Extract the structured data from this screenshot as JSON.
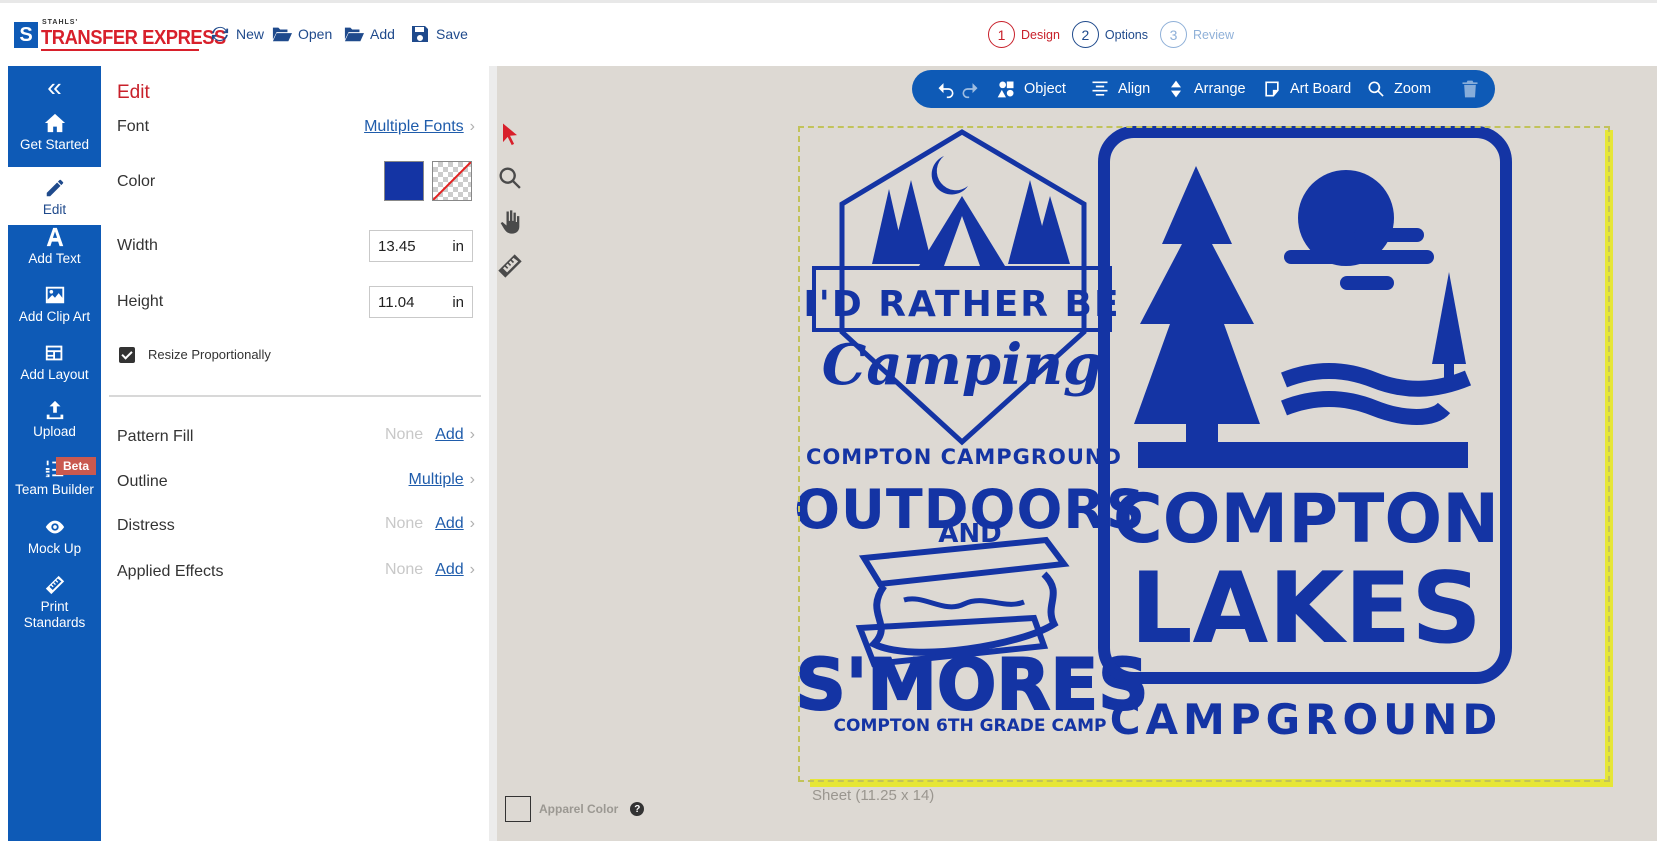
{
  "brand": {
    "small": "STAHLS'",
    "name": "TRANSFER EXPRESS",
    "mark": "S"
  },
  "file_menu": {
    "new": "New",
    "open": "Open",
    "add": "Add",
    "save": "Save"
  },
  "steps": [
    {
      "num": "1",
      "label": "Design"
    },
    {
      "num": "2",
      "label": "Options"
    },
    {
      "num": "3",
      "label": "Review"
    }
  ],
  "nav": {
    "collapse": "«",
    "items": [
      {
        "label": "Get Started"
      },
      {
        "label": "Edit"
      },
      {
        "label": "Add Text"
      },
      {
        "label": "Add Clip Art"
      },
      {
        "label": "Add Layout"
      },
      {
        "label": "Upload"
      },
      {
        "label": "Team Builder",
        "badge": "Beta"
      },
      {
        "label": "Mock Up"
      },
      {
        "label": "Print Standards"
      }
    ]
  },
  "edit_panel": {
    "title": "Edit",
    "font": {
      "label": "Font",
      "value": "Multiple Fonts"
    },
    "color": {
      "label": "Color",
      "swatch": "#1434a4"
    },
    "width": {
      "label": "Width",
      "value": "13.45",
      "unit": "in"
    },
    "height": {
      "label": "Height",
      "value": "11.04",
      "unit": "in"
    },
    "resize": {
      "label": "Resize Proportionally",
      "checked": true
    },
    "pattern_fill": {
      "label": "Pattern Fill",
      "state": "None",
      "action": "Add"
    },
    "outline": {
      "label": "Outline",
      "value": "Multiple"
    },
    "distress": {
      "label": "Distress",
      "state": "None",
      "action": "Add"
    },
    "applied_effects": {
      "label": "Applied Effects",
      "state": "None",
      "action": "Add"
    }
  },
  "toolbar": {
    "object": "Object",
    "align": "Align",
    "arrange": "Arrange",
    "artboard": "Art Board",
    "zoom": "Zoom"
  },
  "design": {
    "badge_top": "I'D RATHER BE",
    "badge_script": "Camping",
    "compton_campground": "COMPTON CAMPGROUND",
    "outdoors": "OUTDOORS",
    "and": "AND",
    "smores": "S'MORES",
    "camp": "COMPTON 6TH GRADE CAMP",
    "compton": "COMPTON",
    "lakes": "LAKES",
    "campground": "CAMPGROUND",
    "ink_color": "#1434a4"
  },
  "sheet_label": "Sheet (11.25 x 14)",
  "apparel_color": {
    "label": "Apparel Color",
    "help": "?"
  }
}
